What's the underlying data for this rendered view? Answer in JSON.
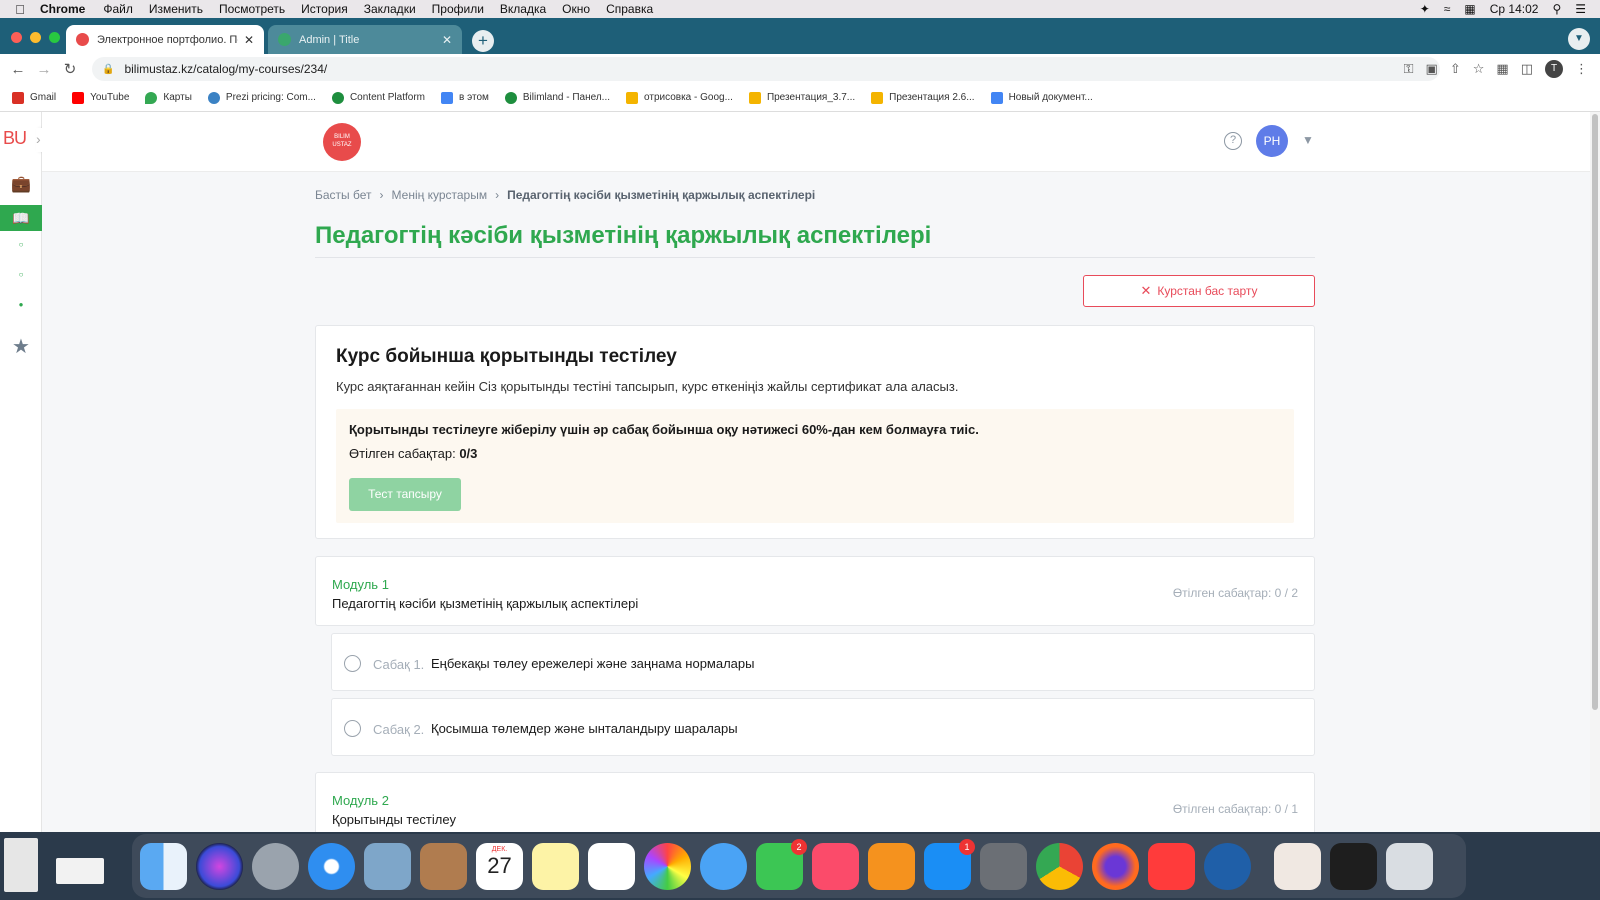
{
  "menubar": {
    "app": "Chrome",
    "items": [
      "Файл",
      "Изменить",
      "Посмотреть",
      "История",
      "Закладки",
      "Профили",
      "Вкладка",
      "Окно",
      "Справка"
    ],
    "clock": "Ср 14:02"
  },
  "tabs": [
    {
      "title": "Электронное портфолио. Пед",
      "favicon_color": "#e84b4b"
    },
    {
      "title": "Admin | Title",
      "favicon_color": "#3aa76d"
    }
  ],
  "address": {
    "url": "bilimustaz.kz/catalog/my-courses/234/",
    "profile_initial": "T"
  },
  "bookmarks": [
    {
      "label": "Gmail",
      "color": "#d93025"
    },
    {
      "label": "YouTube",
      "color": "#ff0000"
    },
    {
      "label": "Карты",
      "color": "#34a853"
    },
    {
      "label": "Prezi pricing: Com...",
      "color": "#3b82c4"
    },
    {
      "label": "Content Platform",
      "color": "#1e8e3e"
    },
    {
      "label": "в этом",
      "color": "#4285f4"
    },
    {
      "label": "Bilimland - Панел...",
      "color": "#1e8e3e"
    },
    {
      "label": "отрисовка - Goog...",
      "color": "#f4b400"
    },
    {
      "label": "Презентация_3.7...",
      "color": "#f4b400"
    },
    {
      "label": "Презентация 2.6...",
      "color": "#f4b400"
    },
    {
      "label": "Новый документ...",
      "color": "#4285f4"
    }
  ],
  "sidebar": {
    "logo": "BU"
  },
  "header": {
    "brand_line1": "BILIM",
    "brand_line2": "USTAZ",
    "avatar": "PH",
    "help": "?"
  },
  "breadcrumb": [
    "Басты бет",
    "Менің курстарым",
    "Педагогтің кәсіби қызметінің қаржылық аспектілері"
  ],
  "page_title": "Педагогтің кәсіби қызметінің қаржылық аспектілері",
  "quit_button": "Курстан бас тарту",
  "final_test": {
    "title": "Курс бойынша қорытынды тестілеу",
    "description": "Курс аяқтағаннан кейін Сіз қорытынды тестіні тапсырып, курс өткеніңіз жайлы сертификат ала аласыз.",
    "requirement": "Қорытынды тестілеуге жіберілу үшін әр сабақ бойынша оқу нәтижесі 60%-дан кем болмауға тиіс.",
    "done_label": "Өтілген сабақтар:",
    "done_value": "0/3",
    "button": "Тест тапсыру"
  },
  "modules": [
    {
      "label": "Модуль 1",
      "title": "Педагогтің кәсіби қызметінің қаржылық аспектілері",
      "progress": "Өтілген сабақтар: 0 / 2",
      "lessons": [
        {
          "num": "Сабақ 1.",
          "title": "Еңбекақы төлеу ережелері және заңнама нормалары"
        },
        {
          "num": "Сабақ 2.",
          "title": "Қосымша төлемдер және ынталандыру шаралары"
        }
      ]
    },
    {
      "label": "Модуль 2",
      "title": "Қорытынды тестілеу",
      "progress": "Өтілген сабақтар: 0 / 1"
    }
  ],
  "dock": {
    "calendar_month": "ДЕК.",
    "calendar_day": "27",
    "facetime_badge": "2",
    "appstore_badge": "1"
  }
}
